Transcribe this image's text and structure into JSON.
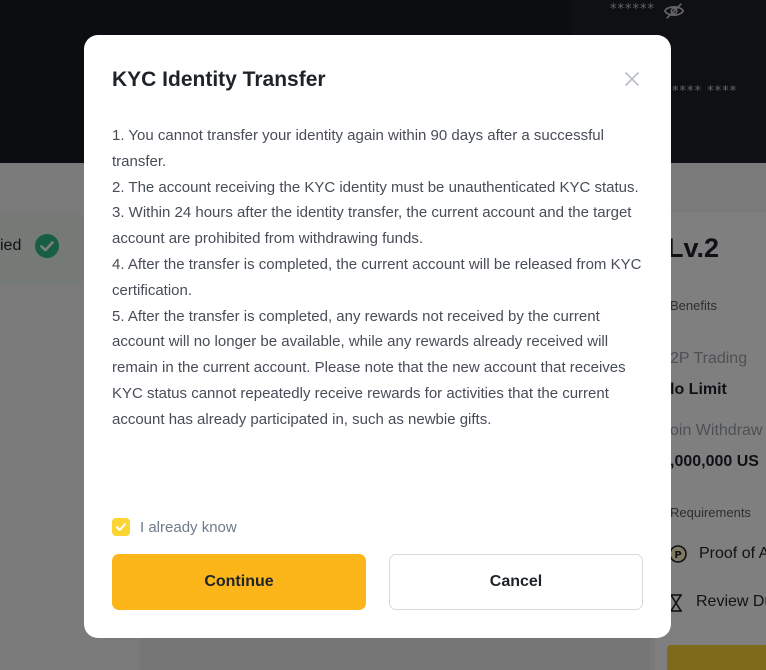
{
  "background": {
    "masked_balance": "******",
    "masked_value": "**** ****",
    "verified_label": "ied",
    "level": "Lv.2",
    "benefits_heading": "Benefits",
    "p2p_label": "2P Trading",
    "p2p_value": "lo Limit",
    "withdraw_label": "oin Withdraw",
    "withdraw_value": ",000,000 US",
    "requirements_heading": "Requirements",
    "proof_label": "Proof of A",
    "review_label": "Review Du"
  },
  "modal": {
    "title": "KYC Identity Transfer",
    "terms": [
      "1. You cannot transfer your identity again within 90 days after a successful transfer.",
      "2. The account receiving the KYC identity must be unauthenticated KYC status.",
      "3. Within 24 hours after the identity transfer, the current account and the target account are prohibited from withdrawing funds.",
      "4. After the transfer is completed, the current account will be released from KYC certification.",
      "5. After the transfer is completed, any rewards not received by the current account will no longer be available, while any rewards already received will remain in the current account. Please note that the new account that receives KYC status cannot repeatedly receive rewards for activities that the current account has already participated in, such as newbie gifts."
    ],
    "acknowledge_label": "I already know",
    "acknowledge_checked": true,
    "continue_label": "Continue",
    "cancel_label": "Cancel"
  },
  "colors": {
    "accent": "#fcb61a",
    "success": "#2ebd85",
    "dark_header": "#181a20"
  }
}
